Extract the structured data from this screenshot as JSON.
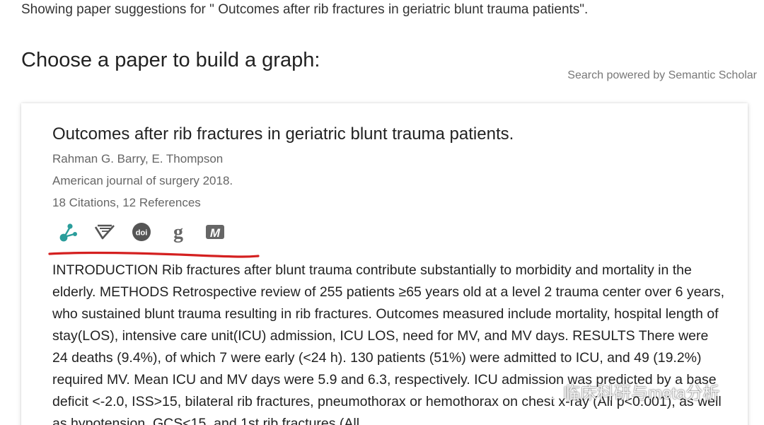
{
  "header": {
    "suggestion_text": "Showing paper suggestions for \" Outcomes after rib fractures in geriatric blunt trauma patients\".",
    "heading": "Choose a paper to build a graph:",
    "powered_by": "Search powered by Semantic Scholar"
  },
  "paper": {
    "title": "Outcomes after rib fractures in geriatric blunt trauma patients.",
    "authors": "Rahman G. Barry, E. Thompson",
    "journal": "American journal of surgery 2018.",
    "counts": "18 Citations, 12 References",
    "icons": [
      {
        "name": "graph-icon",
        "color": "#2a9d9b"
      },
      {
        "name": "semantic-scholar-icon",
        "color": "#555555"
      },
      {
        "name": "doi-icon",
        "color": "#555555"
      },
      {
        "name": "google-scholar-icon",
        "color": "#555555"
      },
      {
        "name": "mendeley-icon",
        "color": "#555555"
      }
    ],
    "abstract": "INTRODUCTION Rib fractures after blunt trauma contribute substantially to morbidity and mortality in the elderly. METHODS Retrospective review of 255 patients ≥65 years old at a level 2 trauma center over 6 years, who sustained blunt trauma resulting in rib fractures. Outcomes measured include mortality, hospital length of stay(LOS), intensive care unit(ICU) admission, ICU LOS, need for MV, and MV days. RESULTS There were 24 deaths (9.4%), of which 7 were early (<24 h). 130 patients (51%) were admitted to ICU, and 49 (19.2%) required MV. Mean ICU and MV days were 5.9 and 6.3, respectively. ICU admission was predicted by a base deficit <-2.0, ISS>15, bilateral rib fractures, pneumothorax or hemothorax on chest x-ray (All p<0.001), as well as hypotension, GCS<15, and 1st rib fractures (All"
  },
  "annotation": {
    "underline_color": "#d42020"
  },
  "watermark": {
    "text": "临床科研与meta分析"
  }
}
